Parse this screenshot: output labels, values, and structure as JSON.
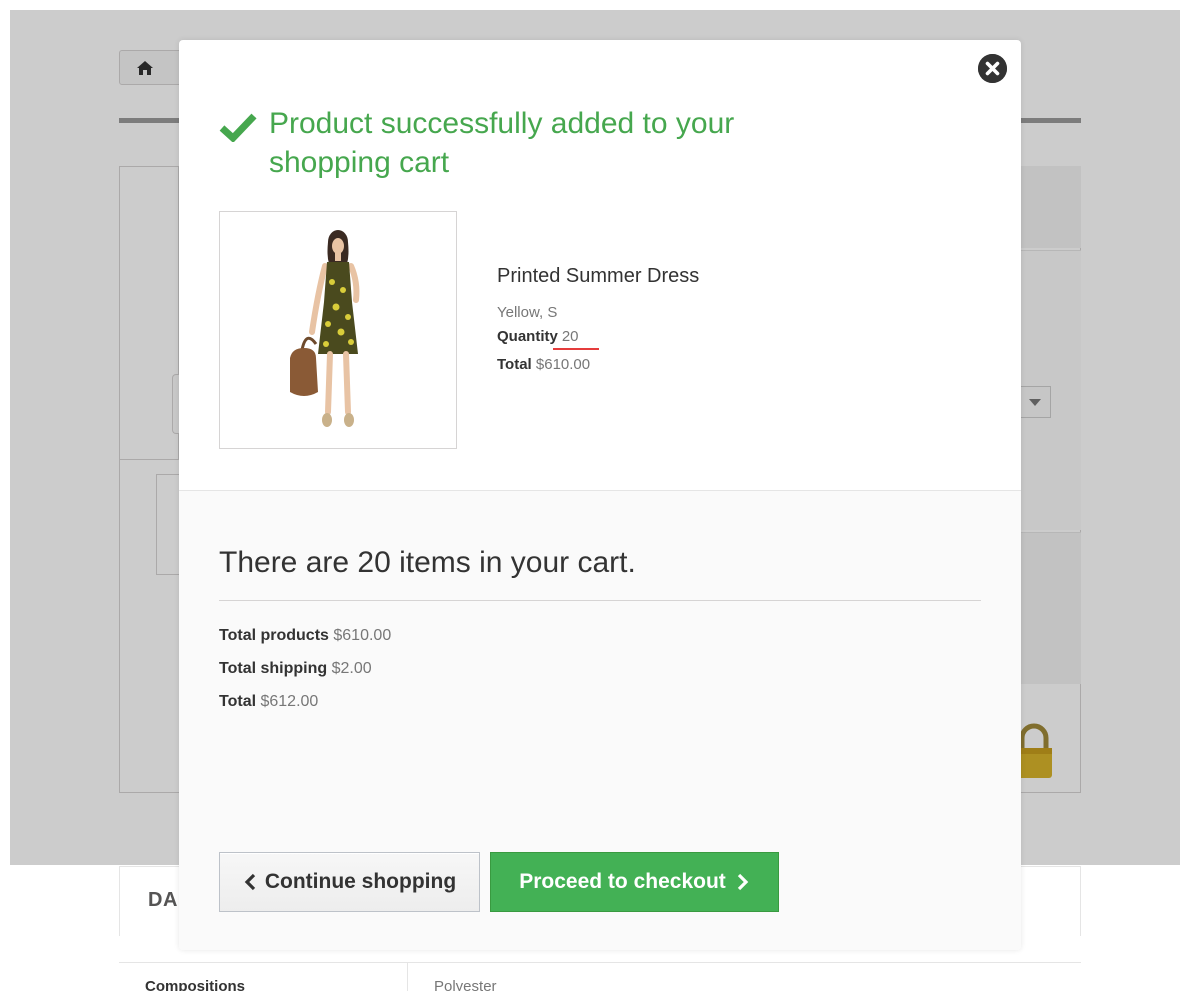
{
  "background_page": {
    "section_heading": "DA",
    "compositions_label": "Compositions",
    "compositions_value": "Polyester"
  },
  "modal": {
    "success_message": "Product successfully added to your shopping cart",
    "product": {
      "name": "Printed Summer Dress",
      "attributes": "Yellow, S",
      "quantity_label": "Quantity",
      "quantity_value": "20",
      "total_label": "Total",
      "total_value": "$610.00"
    },
    "cart": {
      "heading": "There are 20 items in your cart.",
      "total_products_label": "Total products",
      "total_products_value": "$610.00",
      "total_shipping_label": "Total shipping",
      "total_shipping_value": "$2.00",
      "total_label": "Total",
      "total_value": "$612.00"
    },
    "buttons": {
      "continue_label": "Continue shopping",
      "checkout_label": "Proceed to checkout"
    }
  },
  "icons": {
    "home": "home-icon",
    "close": "close-icon",
    "success": "checkmark-icon",
    "continue_chevron": "chevron-left-icon",
    "checkout_chevron": "chevron-right-icon",
    "lock": "lock-icon"
  },
  "colors": {
    "success_green": "#46a74e",
    "checkout_button": "#43b155",
    "quantity_underline": "#e53c3c",
    "overlay": "rgba(0,0,0,0.2)"
  }
}
